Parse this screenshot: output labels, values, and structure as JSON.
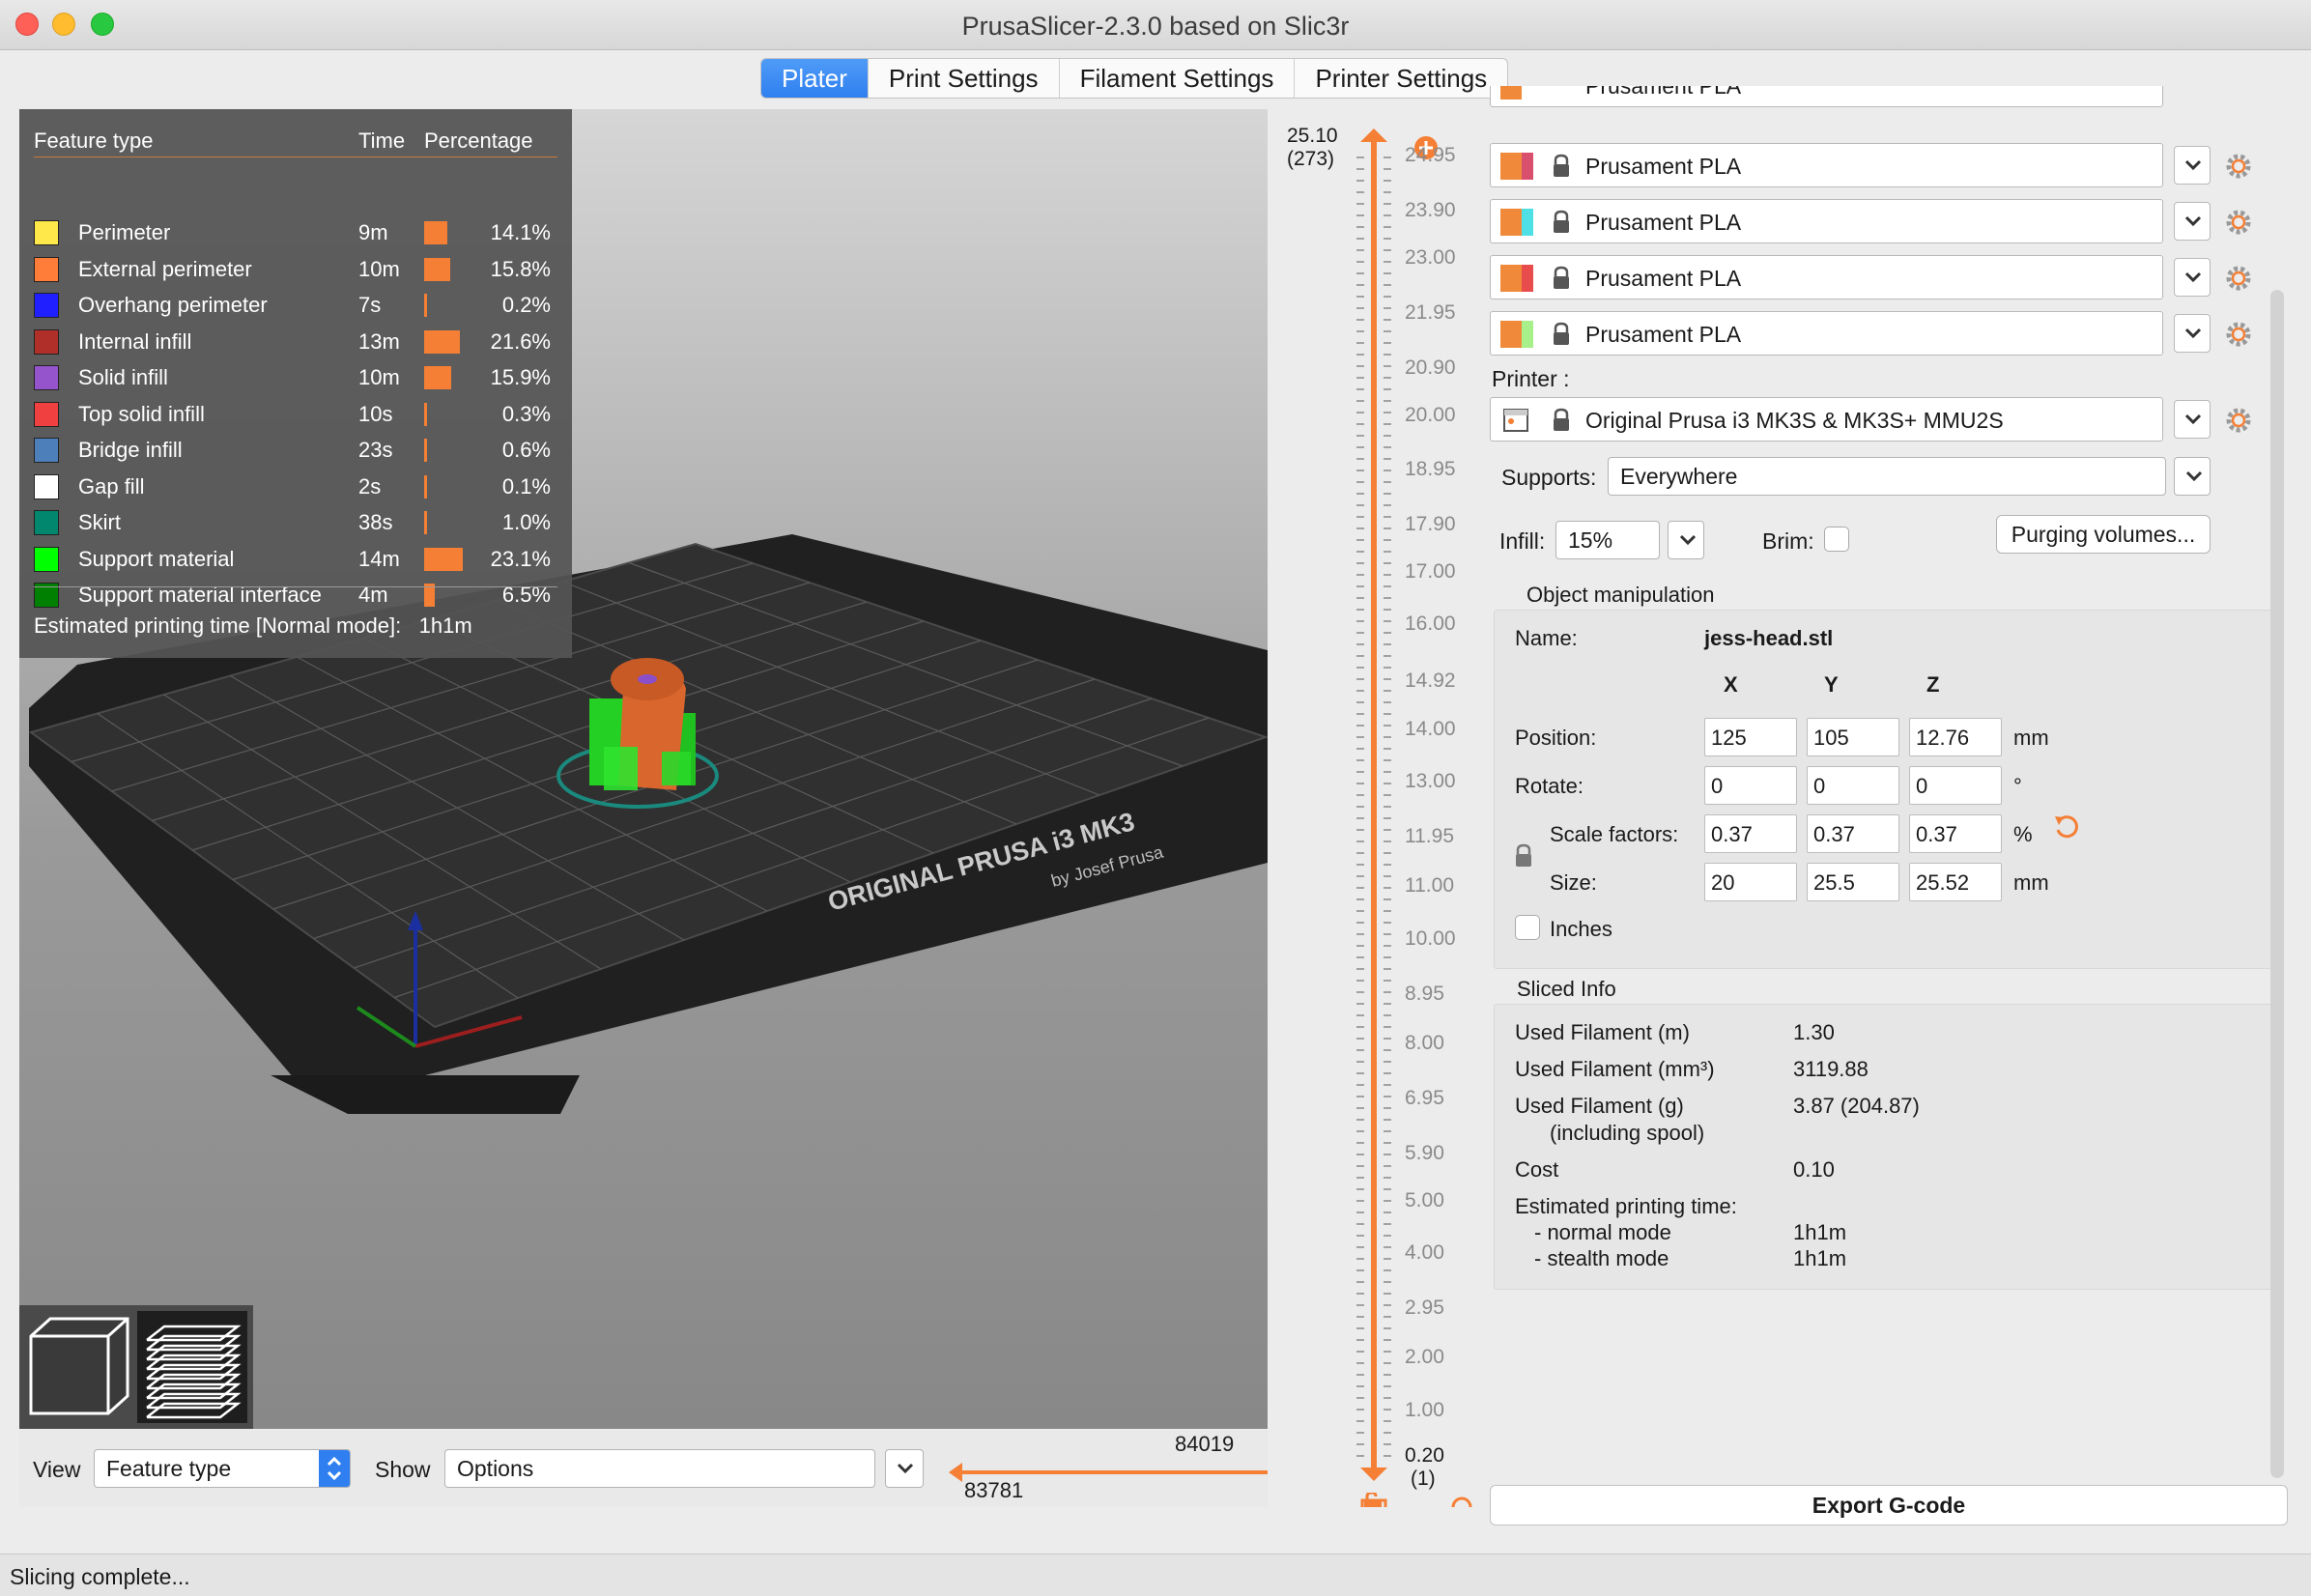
{
  "window": {
    "title": "PrusaSlicer-2.3.0 based on Slic3r"
  },
  "tabs": [
    {
      "label": "Plater",
      "active": true
    },
    {
      "label": "Print Settings",
      "active": false
    },
    {
      "label": "Filament Settings",
      "active": false
    },
    {
      "label": "Printer Settings",
      "active": false
    }
  ],
  "legend": {
    "headers": {
      "feature": "Feature type",
      "time": "Time",
      "percentage": "Percentage"
    },
    "rows": [
      {
        "name": "Perimeter",
        "time": "9m",
        "percent": "14.1%",
        "value": 14.1,
        "color": "#ffe94a"
      },
      {
        "name": "External perimeter",
        "time": "10m",
        "percent": "15.8%",
        "value": 15.8,
        "color": "#ff7d38"
      },
      {
        "name": "Overhang perimeter",
        "time": "7s",
        "percent": "0.2%",
        "value": 0.2,
        "color": "#1f1fff"
      },
      {
        "name": "Internal infill",
        "time": "13m",
        "percent": "21.6%",
        "value": 21.6,
        "color": "#b03029"
      },
      {
        "name": "Solid infill",
        "time": "10m",
        "percent": "15.9%",
        "value": 15.9,
        "color": "#9654cc"
      },
      {
        "name": "Top solid infill",
        "time": "10s",
        "percent": "0.3%",
        "value": 0.3,
        "color": "#f04040"
      },
      {
        "name": "Bridge infill",
        "time": "23s",
        "percent": "0.6%",
        "value": 0.6,
        "color": "#4d80ba"
      },
      {
        "name": "Gap fill",
        "time": "2s",
        "percent": "0.1%",
        "value": 0.1,
        "color": "#ffffff"
      },
      {
        "name": "Skirt",
        "time": "38s",
        "percent": "1.0%",
        "value": 1.0,
        "color": "#00876e"
      },
      {
        "name": "Support material",
        "time": "14m",
        "percent": "23.1%",
        "value": 23.1,
        "color": "#00ff00"
      },
      {
        "name": "Support material interface",
        "time": "4m",
        "percent": "6.5%",
        "value": 6.5,
        "color": "#008000"
      }
    ],
    "estimated_label": "Estimated printing time [Normal mode]:",
    "estimated_value": "1h1m"
  },
  "bed": {
    "brand_line1": "ORIGINAL PRUSA i3 MK3",
    "brand_line2": "by Josef Prusa"
  },
  "bottom": {
    "view_label": "View",
    "view_value": "Feature type",
    "show_label": "Show",
    "show_value": "Options",
    "range_right": "84019",
    "range_left": "83781"
  },
  "layer_slider": {
    "top_value": "25.10",
    "top_layer": "(273)",
    "bottom_value": "0.20",
    "bottom_layer": "(1)",
    "ticks": [
      "24.95",
      "23.90",
      "23.00",
      "21.95",
      "20.90",
      "20.00",
      "18.95",
      "17.90",
      "17.00",
      "16.00",
      "14.92",
      "14.00",
      "13.00",
      "11.95",
      "11.00",
      "10.00",
      "8.95",
      "8.00",
      "6.95",
      "5.90",
      "5.00",
      "4.00",
      "2.95",
      "2.00",
      "1.00"
    ]
  },
  "filaments": [
    {
      "name": "Prusament PLA",
      "accent": "#d94f6e"
    },
    {
      "name": "Prusament PLA",
      "accent": "#4fe0e6"
    },
    {
      "name": "Prusament PLA",
      "accent": "#e84c4c"
    },
    {
      "name": "Prusament PLA",
      "accent": "#a8f08a"
    }
  ],
  "printer": {
    "label": "Printer :",
    "value": "Original Prusa i3 MK3S & MK3S+ MMU2S"
  },
  "supports": {
    "label": "Supports:",
    "value": "Everywhere"
  },
  "infill": {
    "label": "Infill:",
    "value": "15%"
  },
  "brim": {
    "label": "Brim:"
  },
  "purging_button": "Purging volumes...",
  "object_manipulation": {
    "title": "Object manipulation",
    "name_label": "Name:",
    "name_value": "jess-head.stl",
    "axes": [
      "X",
      "Y",
      "Z"
    ],
    "position": {
      "label": "Position:",
      "values": [
        "125",
        "105",
        "12.76"
      ],
      "unit": "mm"
    },
    "rotate": {
      "label": "Rotate:",
      "values": [
        "0",
        "0",
        "0"
      ],
      "unit": "°"
    },
    "scale": {
      "label": "Scale factors:",
      "values": [
        "0.37",
        "0.37",
        "0.37"
      ],
      "unit": "%"
    },
    "size": {
      "label": "Size:",
      "values": [
        "20",
        "25.5",
        "25.52"
      ],
      "unit": "mm"
    },
    "inches_label": "Inches"
  },
  "sliced_info": {
    "title": "Sliced Info",
    "used_m_label": "Used Filament (m)",
    "used_m": "1.30",
    "used_mm3_label": "Used Filament (mm³)",
    "used_mm3": "3119.88",
    "used_g_label": "Used Filament (g)",
    "used_g_sub": "(including spool)",
    "used_g": "3.87 (204.87)",
    "cost_label": "Cost",
    "cost": "0.10",
    "est_label": "Estimated printing time:",
    "normal_label": "- normal mode",
    "normal": "1h1m",
    "stealth_label": "- stealth mode",
    "stealth": "1h1m"
  },
  "export_button": "Export G-code",
  "status": "Slicing complete..."
}
